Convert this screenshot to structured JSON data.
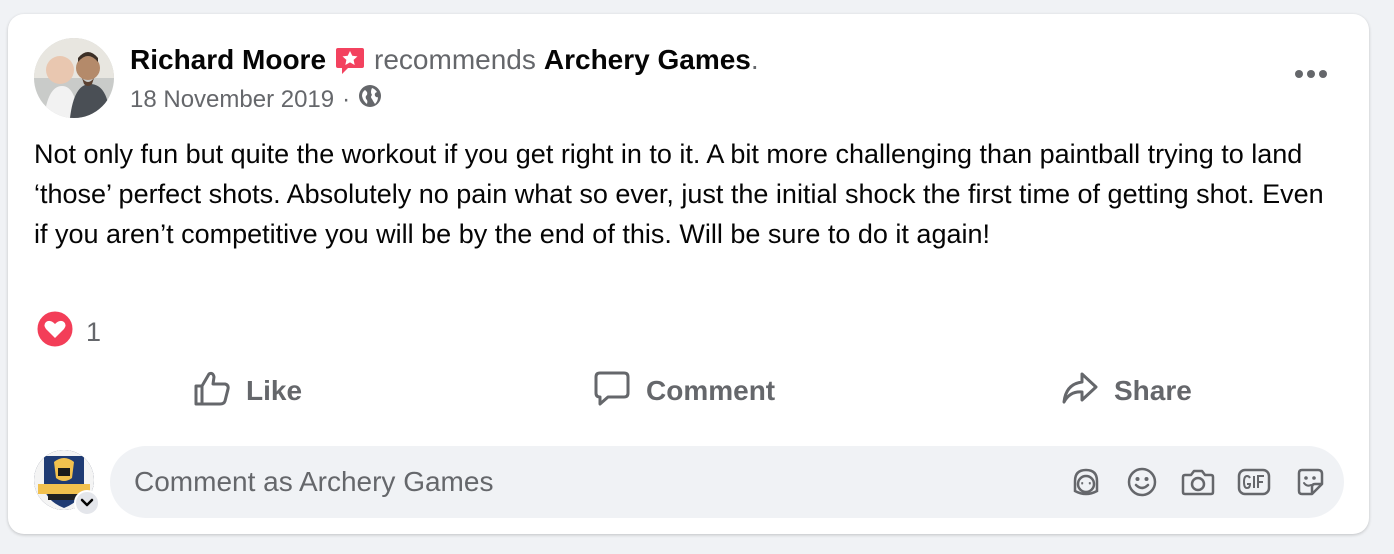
{
  "post": {
    "author": "Richard Moore",
    "verb": "recommends",
    "page": "Archery Games",
    "trailing_punct": ".",
    "date": "18 November 2019",
    "separator": "·",
    "privacy_icon": "globe-icon",
    "body": "Not only fun but quite the workout if you get right in to it. A bit more challenging than paintball trying to land ‘those’ perfect shots. Absolutely no pain what so ever, just the initial shock the first time of getting shot. Even if you aren’t competitive you will be by the end of this. Will be sure to do it again!",
    "reaction_icon": "heart-reaction-icon",
    "reaction_count": "1"
  },
  "actions": {
    "like": "Like",
    "comment": "Comment",
    "share": "Share"
  },
  "composer": {
    "placeholder": "Comment as Archery Games",
    "tools": [
      "avatar-sticker-icon",
      "emoji-icon",
      "camera-icon",
      "gif-icon",
      "sticker-icon"
    ]
  },
  "colors": {
    "text": "#050505",
    "secondary": "#65676b",
    "background": "#f0f2f5",
    "heart": "#f33e58",
    "badge": "#f3425f"
  }
}
